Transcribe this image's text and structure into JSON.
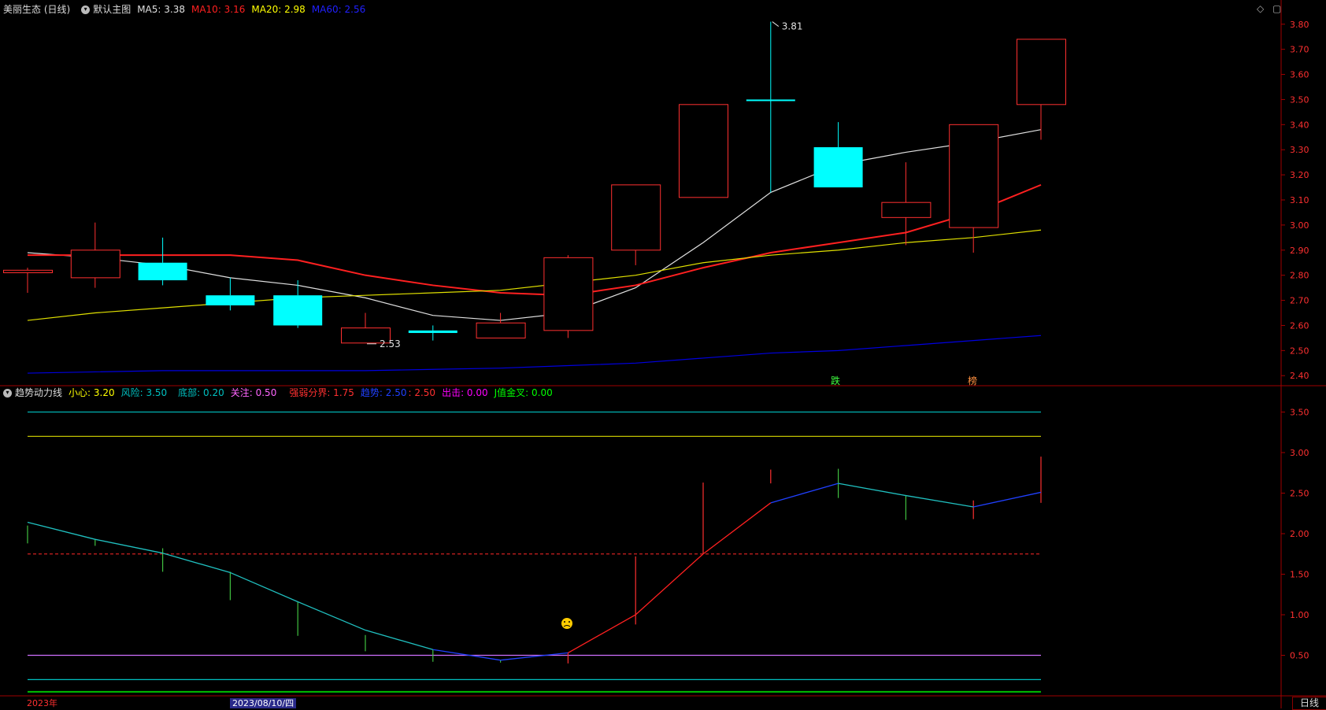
{
  "header_main": {
    "title": "美丽生态 (日线)",
    "template": "默认主图",
    "items": [
      {
        "label": "MA5: 3.38",
        "color": "#e0e0e0"
      },
      {
        "label": "MA10: 3.16",
        "color": "#ff2020"
      },
      {
        "label": "MA20: 2.98",
        "color": "#ffff00"
      },
      {
        "label": "MA60: 2.56",
        "color": "#0000ff"
      }
    ]
  },
  "header_sub": {
    "title": "趋势动力线",
    "items": [
      {
        "label": "小心: 3.20",
        "color": "#ffff00"
      },
      {
        "label": "风险: 3.50",
        "color": "#00c0c0"
      },
      {
        "label": "底部: 0.20",
        "color": "#00c0c0"
      },
      {
        "label": "关注: 0.50",
        "color": "#ff66ff"
      },
      {
        "label": "强弱分界: 1.75",
        "color": "#ff3030"
      },
      {
        "label": "趋势: 2.50",
        "color": "#2040ff"
      },
      {
        "label": ": 2.50",
        "color": "#ff3030"
      },
      {
        "label": "出击: 0.00",
        "color": "#ff00ff"
      },
      {
        "label": "J值金叉: 0.00",
        "color": "#00ff00"
      }
    ]
  },
  "window_controls": {
    "diamond": "◇",
    "restore": "▢"
  },
  "date_labels": {
    "start": "2023年",
    "cursor": "2023/08/10/四"
  },
  "period_button": "日线",
  "annotations": {
    "high": "3.81",
    "low": "2.53",
    "marker_a": "跌",
    "marker_b": "榜"
  },
  "colors": {
    "up": "#ff3030",
    "down": "#00ffff",
    "grid": "#5a0000"
  },
  "chart_data": {
    "type": "candlestick",
    "main": {
      "ylim": [
        2.36,
        3.84
      ],
      "yticks": [
        "2.40",
        "2.50",
        "2.60",
        "2.70",
        "2.80",
        "2.90",
        "3.00",
        "3.10",
        "3.20",
        "3.30",
        "3.40",
        "3.50",
        "3.60",
        "3.70",
        "3.80"
      ],
      "candles": [
        {
          "o": 2.81,
          "h": 2.83,
          "l": 2.73,
          "c": 2.82
        },
        {
          "o": 2.79,
          "h": 3.01,
          "l": 2.75,
          "c": 2.9
        },
        {
          "o": 2.85,
          "h": 2.95,
          "l": 2.76,
          "c": 2.78
        },
        {
          "o": 2.72,
          "h": 2.79,
          "l": 2.66,
          "c": 2.68
        },
        {
          "o": 2.72,
          "h": 2.78,
          "l": 2.59,
          "c": 2.6
        },
        {
          "o": 2.53,
          "h": 2.65,
          "l": 2.53,
          "c": 2.59
        },
        {
          "o": 2.58,
          "h": 2.6,
          "l": 2.54,
          "c": 2.57
        },
        {
          "o": 2.55,
          "h": 2.65,
          "l": 2.55,
          "c": 2.61
        },
        {
          "o": 2.58,
          "h": 2.88,
          "l": 2.55,
          "c": 2.87
        },
        {
          "o": 2.9,
          "h": 3.16,
          "l": 2.84,
          "c": 3.16
        },
        {
          "o": 3.11,
          "h": 3.48,
          "l": 3.11,
          "c": 3.48
        },
        {
          "o": 3.5,
          "h": 3.81,
          "l": 3.13,
          "c": 3.5
        },
        {
          "o": 3.31,
          "h": 3.41,
          "l": 3.15,
          "c": 3.15
        },
        {
          "o": 3.03,
          "h": 3.25,
          "l": 2.92,
          "c": 3.09
        },
        {
          "o": 2.99,
          "h": 3.4,
          "l": 2.89,
          "c": 3.4
        },
        {
          "o": 3.48,
          "h": 3.74,
          "l": 3.34,
          "c": 3.74
        }
      ],
      "series": [
        {
          "name": "MA5",
          "color": "#e0e0e0",
          "values": [
            2.89,
            2.87,
            2.84,
            2.79,
            2.76,
            2.71,
            2.64,
            2.62,
            2.65,
            2.75,
            2.93,
            3.13,
            3.24,
            3.29,
            3.33,
            3.38
          ]
        },
        {
          "name": "MA10",
          "color": "#ff2020",
          "values": [
            2.88,
            2.88,
            2.88,
            2.88,
            2.86,
            2.8,
            2.76,
            2.73,
            2.72,
            2.76,
            2.83,
            2.89,
            2.93,
            2.97,
            3.05,
            3.16
          ]
        },
        {
          "name": "MA20",
          "color": "#e0e000",
          "values": [
            2.62,
            2.65,
            2.67,
            2.69,
            2.71,
            2.72,
            2.73,
            2.74,
            2.77,
            2.8,
            2.85,
            2.88,
            2.9,
            2.93,
            2.95,
            2.98
          ]
        },
        {
          "name": "MA60",
          "color": "#0000e0",
          "values": [
            2.41,
            2.415,
            2.42,
            2.42,
            2.42,
            2.42,
            2.425,
            2.43,
            2.44,
            2.45,
            2.47,
            2.49,
            2.5,
            2.52,
            2.54,
            2.56
          ]
        }
      ]
    },
    "sub": {
      "ylim": [
        0.0,
        3.65
      ],
      "yticks": [
        "0.50",
        "1.00",
        "1.50",
        "2.00",
        "2.50",
        "3.00",
        "3.50"
      ],
      "levels": [
        {
          "name": "风险",
          "value": 3.5,
          "color": "#00c0c0",
          "dash": false
        },
        {
          "name": "小心",
          "value": 3.2,
          "color": "#c0c000",
          "dash": false
        },
        {
          "name": "强弱分界",
          "value": 1.75,
          "color": "#d02020",
          "dash": true
        },
        {
          "name": "关注",
          "value": 0.5,
          "color": "#d070ff",
          "dash": false
        },
        {
          "name": "底部",
          "value": 0.2,
          "color": "#00c0c0",
          "dash": false
        },
        {
          "name": "J",
          "value": 0.05,
          "color": "#00c000",
          "dash": false
        }
      ],
      "trend": [
        2.14,
        1.93,
        1.76,
        1.52,
        1.16,
        0.81,
        0.57,
        0.44,
        0.53,
        1.0,
        1.75,
        2.38,
        2.62,
        2.47,
        2.33,
        2.51
      ],
      "bars": [
        {
          "top": 2.1,
          "bottom": 1.88,
          "color": "#40c040"
        },
        {
          "top": 1.93,
          "bottom": 1.85,
          "color": "#40c040"
        },
        {
          "top": 1.82,
          "bottom": 1.53,
          "color": "#40c040"
        },
        {
          "top": 1.53,
          "bottom": 1.18,
          "color": "#40c040"
        },
        {
          "top": 1.16,
          "bottom": 0.74,
          "color": "#40c040"
        },
        {
          "top": 0.75,
          "bottom": 0.55,
          "color": "#40c040"
        },
        {
          "top": 0.57,
          "bottom": 0.42,
          "color": "#40c040"
        },
        {
          "top": 0.44,
          "bottom": 0.41,
          "color": "#40c040"
        },
        {
          "top": 0.53,
          "bottom": 0.4,
          "color": "#ff3030"
        },
        {
          "top": 1.72,
          "bottom": 0.88,
          "color": "#ff3030"
        },
        {
          "top": 2.63,
          "bottom": 1.75,
          "color": "#ff3030"
        },
        {
          "top": 2.79,
          "bottom": 2.62,
          "color": "#ff3030"
        },
        {
          "top": 2.8,
          "bottom": 2.44,
          "color": "#40c040"
        },
        {
          "top": 2.47,
          "bottom": 2.17,
          "color": "#40c040"
        },
        {
          "top": 2.41,
          "bottom": 2.18,
          "color": "#ff3030"
        },
        {
          "top": 2.95,
          "bottom": 2.38,
          "color": "#ff3030"
        }
      ]
    }
  }
}
